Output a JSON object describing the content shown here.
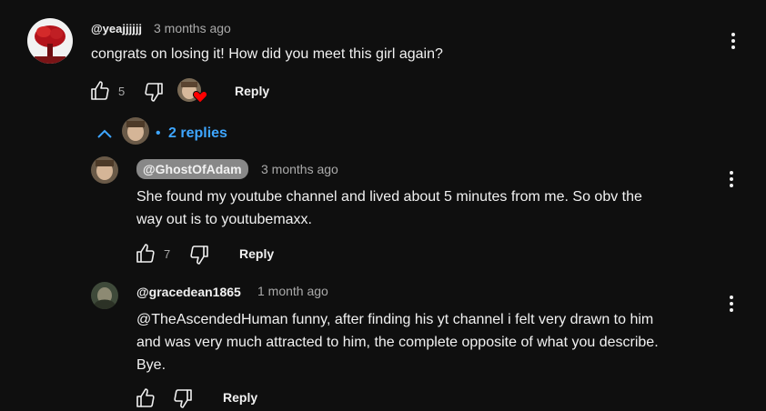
{
  "colors": {
    "background": "#0f0f0f",
    "accent_link": "#3ea6ff",
    "text": "#f1f1f1",
    "muted": "#aaaaaa",
    "chip": "#888888",
    "heart": "#ff0000"
  },
  "comment": {
    "handle": "@yeajjjjjj",
    "time": "3 months ago",
    "text": "congrats on losing it! How did you meet this girl again?",
    "like_count": "5",
    "reply_label": "Reply",
    "icons": {
      "like": "thumbs-up-icon",
      "dislike": "thumbs-down-icon",
      "menu": "more-vert-icon",
      "hearted": "creator-heart-icon"
    }
  },
  "replies_toggle": {
    "label": "2 replies",
    "bullet": "•",
    "icon": "chevron-up-icon"
  },
  "replies": [
    {
      "handle": "@GhostOfAdam",
      "time": "3 months ago",
      "text_line1": "She found my youtube channel and lived about 5 minutes from me. So obv the",
      "text_line2": "way out is to youtubemaxx.",
      "like_count": "7",
      "reply_label": "Reply"
    },
    {
      "handle": "@gracedean1865",
      "time": "1 month ago",
      "text_line1": "@TheAscendedHuman  funny, after finding his yt channel i felt very drawn to him",
      "text_line2": "and was very much attracted to him, the complete opposite of what you describe.",
      "text_line3": "Bye.",
      "reply_label": "Reply"
    }
  ]
}
